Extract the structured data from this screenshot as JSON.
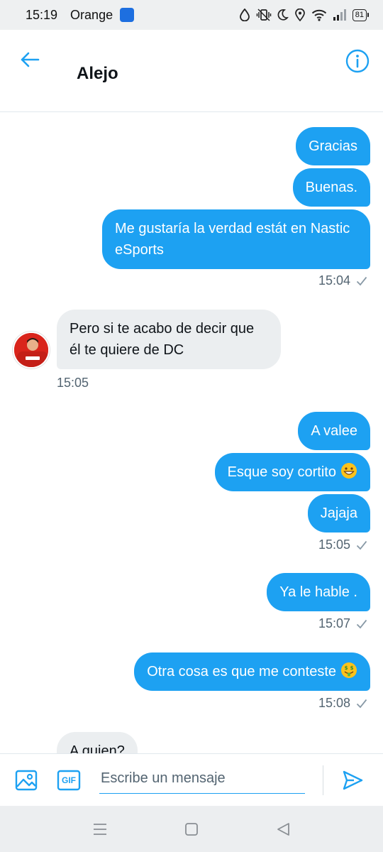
{
  "status_bar": {
    "time": "15:19",
    "carrier": "Orange",
    "battery": "81"
  },
  "header": {
    "title": "Alejo"
  },
  "messages": [
    {
      "direction": "out",
      "text": "Gracias"
    },
    {
      "direction": "out",
      "text": "Buenas."
    },
    {
      "direction": "out",
      "text": "Me gustaría la verdad estát en Nastic eSports"
    },
    {
      "direction": "out",
      "time": "15:04"
    },
    {
      "direction": "in",
      "text": "Pero si te acabo de decir que él te quiere de DC"
    },
    {
      "direction": "in",
      "time": "15:05"
    },
    {
      "direction": "out",
      "text": "A valee"
    },
    {
      "direction": "out",
      "text": "Esque soy cortito",
      "emoji": "grinning-face"
    },
    {
      "direction": "out",
      "text": "Jajaja"
    },
    {
      "direction": "out",
      "time": "15:05"
    },
    {
      "direction": "out",
      "text": "Ya le hable ."
    },
    {
      "direction": "out",
      "time": "15:07"
    },
    {
      "direction": "out",
      "text": "Otra cosa es que me conteste",
      "emoji": "money-mouth-face"
    },
    {
      "direction": "out",
      "time": "15:08"
    },
    {
      "direction": "in",
      "text": "A quien?"
    }
  ],
  "composer": {
    "placeholder": "Escribe un mensaje",
    "gif_label": "GIF"
  },
  "colors": {
    "accent": "#1da1f2",
    "incoming_bubble": "#ebeef0",
    "meta_text": "#536471"
  }
}
